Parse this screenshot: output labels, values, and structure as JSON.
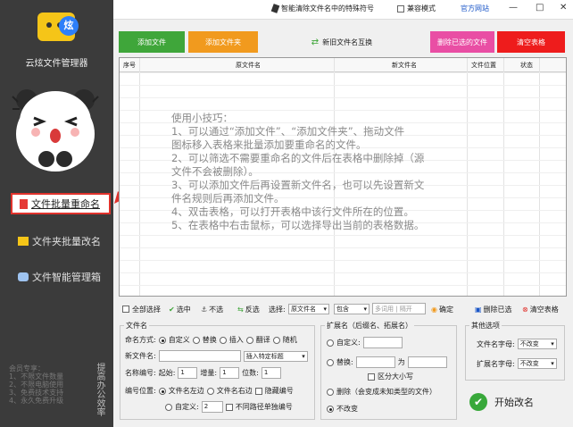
{
  "app": {
    "name": "云炫文件管理器",
    "logo_text": "炫"
  },
  "sidebar": {
    "items": [
      {
        "label": "文件批量重命名"
      },
      {
        "label": "文件夹批量改名"
      },
      {
        "label": "文件智能管理箱"
      }
    ],
    "footer_lines": [
      "会员专享：",
      "1、不限文件数量",
      "2、不限电脑使用",
      "3、免费技术支持",
      "4、永久免费升级"
    ],
    "vertical_text": "提高办公效率"
  },
  "topbar": {
    "special_chars": "智能清除文件名中的特殊符号",
    "compat_mode": "兼容模式",
    "official_site": "官方网站",
    "min": "—",
    "restore": "□",
    "close": "✕"
  },
  "actions": {
    "add_file": "添加文件",
    "add_folder": "添加文件夹",
    "swap": "新旧文件名互换",
    "delete_selected": "删除已选的文件",
    "clear_list": "清空表格"
  },
  "table": {
    "headers": [
      "序号",
      "原文件名",
      "新文件名",
      "文件位置",
      "状态"
    ],
    "tips": [
      "使用小技巧：",
      "1、可以通过“添加文件”、“添加文件夹”、拖动文件",
      "图标移入表格来批量添加要重命名的文件。",
      "2、可以筛选不需要重命名的文件后在表格中删除掉（源",
      "文件不会被删除）。",
      "3、可以添加文件后再设置新文件名，也可以先设置新文",
      "件名规则后再添加文件。",
      "4、双击表格，可以打开表格中该行文件所在的位置。",
      "5、在表格中右击鼠标，可以选择导出当前的表格数据。"
    ]
  },
  "selection_bar": {
    "select_all": "全部选择",
    "check": "选中",
    "uncheck": "不选",
    "invert": "反选",
    "select_label": "选择:",
    "field": "原文件名",
    "mode": "包含",
    "keyword_placeholder": "多词用 | 隔开",
    "confirm": "确定",
    "delete_selected": "删除已选",
    "clear_table": "清空表格"
  },
  "filename_panel": {
    "title": "文件名",
    "mode_label": "命名方式:",
    "modes": [
      "自定义",
      "替换",
      "插入",
      "翻译",
      "随机"
    ],
    "new_name_label": "新文件名:",
    "new_name_value": "",
    "insert_label": "插入特定标题",
    "seq_label": "名称编号:",
    "start_label": "起始:",
    "start_value": "1",
    "step_label": "增量:",
    "step_value": "1",
    "digits_label": "位数:",
    "digits_value": "1",
    "pos_label": "编号位置:",
    "pos_left": "文件名左边",
    "pos_right": "文件名右边",
    "hide_seq": "隐藏编号",
    "custom": "自定义:",
    "custom_value": "2",
    "separate": "不同路径单独编号"
  },
  "ext_panel": {
    "title": "扩展名（后缀名、拓展名）",
    "custom": "自定义:",
    "replace": "替换:",
    "to": "为",
    "case": "区分大小写",
    "remove": "删除（会变成未知类型的文件）",
    "unchanged": "不改变"
  },
  "other_panel": {
    "title": "其他选项",
    "filename_case_label": "文件名字母:",
    "filename_case": "不改变",
    "ext_case_label": "扩展名字母:",
    "ext_case": "不改变"
  },
  "start_button": "开始改名",
  "colors": {
    "sidebar": "#3b3b3b",
    "green": "#3fa63a",
    "orange": "#f19a1e",
    "pink": "#e94ea4",
    "red": "#ee1c1c"
  }
}
